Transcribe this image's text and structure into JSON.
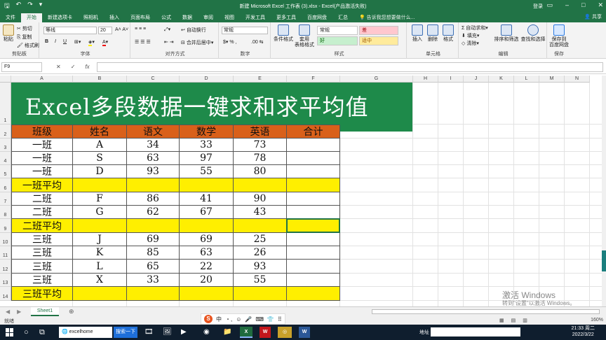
{
  "title_bar": {
    "title": "新建 Microsoft Excel 工作表 (3).xlsx - Excel(产品激活失败)",
    "signin": "登录",
    "share": "共享"
  },
  "menu": {
    "tabs": [
      "文件",
      "开始",
      "新建选项卡",
      "照相机",
      "插入",
      "页面布局",
      "公式",
      "数据",
      "审阅",
      "视图",
      "开发工具",
      "更多工具",
      "百度网盘",
      "汇总"
    ],
    "active_tab": "开始",
    "tell_me": "告诉我您想要做什么..."
  },
  "ribbon": {
    "clipboard": {
      "label": "剪贴板",
      "paste": "粘贴",
      "cut": "剪切",
      "copy": "复制",
      "format_painter": "格式刷"
    },
    "font": {
      "label": "字体",
      "name": "等线",
      "size": "20",
      "bold": "B",
      "italic": "I",
      "underline": "U"
    },
    "alignment": {
      "label": "对齐方式",
      "wrap": "自动换行",
      "merge": "合并后居中"
    },
    "number": {
      "label": "数字",
      "format": "常规",
      "percent": "%"
    },
    "styles": {
      "label": "样式",
      "cond_format": "条件格式",
      "table_format": "套用\n表格格式",
      "normal": "常规",
      "bad": "差",
      "good": "好",
      "neutral": "适中"
    },
    "cells": {
      "label": "单元格",
      "insert": "插入",
      "delete": "删除",
      "format": "格式"
    },
    "editing": {
      "label": "编辑",
      "autosum": "自动求和",
      "fill": "填充",
      "clear": "清除",
      "sort_filter": "排序和筛选",
      "find_select": "查找和选择"
    },
    "save": {
      "label": "保存",
      "save_to_baidu": "保存到\n百度网盘"
    }
  },
  "formula_bar": {
    "name_box": "F9",
    "cancel": "✕",
    "enter": "✓",
    "fx": "fx",
    "formula": ""
  },
  "columns": [
    "A",
    "B",
    "C",
    "D",
    "E",
    "F",
    "G",
    "H",
    "I",
    "J",
    "K",
    "L",
    "M",
    "N"
  ],
  "rows": [
    "1",
    "2",
    "3",
    "4",
    "5",
    "6",
    "7",
    "8",
    "9",
    "10",
    "11",
    "12",
    "13",
    "14"
  ],
  "banner_text": "Excel多段数据一键求和求平均值",
  "table": {
    "header": [
      "班级",
      "姓名",
      "语文",
      "数学",
      "英语",
      "合计"
    ],
    "rows": [
      {
        "type": "data",
        "cells": [
          "一班",
          "A",
          "34",
          "33",
          "73",
          ""
        ]
      },
      {
        "type": "data",
        "cells": [
          "一班",
          "S",
          "63",
          "97",
          "78",
          ""
        ]
      },
      {
        "type": "data",
        "cells": [
          "一班",
          "D",
          "93",
          "55",
          "80",
          ""
        ]
      },
      {
        "type": "avg",
        "cells": [
          "一班平均",
          "",
          "",
          "",
          "",
          ""
        ]
      },
      {
        "type": "data",
        "cells": [
          "二班",
          "F",
          "86",
          "41",
          "90",
          ""
        ]
      },
      {
        "type": "data",
        "cells": [
          "二班",
          "G",
          "62",
          "67",
          "43",
          ""
        ]
      },
      {
        "type": "avg",
        "cells": [
          "二班平均",
          "",
          "",
          "",
          "",
          ""
        ]
      },
      {
        "type": "data",
        "cells": [
          "三班",
          "J",
          "69",
          "69",
          "25",
          ""
        ]
      },
      {
        "type": "data",
        "cells": [
          "三班",
          "K",
          "85",
          "63",
          "26",
          ""
        ]
      },
      {
        "type": "data",
        "cells": [
          "三班",
          "L",
          "65",
          "22",
          "93",
          ""
        ]
      },
      {
        "type": "data",
        "cells": [
          "三班",
          "X",
          "33",
          "20",
          "55",
          ""
        ]
      },
      {
        "type": "avg",
        "cells": [
          "三班平均",
          "",
          "",
          "",
          "",
          ""
        ]
      }
    ]
  },
  "sheet_tabs": {
    "active": "Sheet1"
  },
  "status": {
    "ready": "就绪",
    "zoom": "160%"
  },
  "watermark": {
    "line1": "激活 Windows",
    "line2": "转到\"设置\"以激活 Windows。"
  },
  "ime": {
    "lang": "中"
  },
  "taskbar": {
    "search": "excelhome",
    "search_btn": "搜索一下",
    "address_label": "地址",
    "time": "21:33 周二",
    "date": "2022/3/22"
  },
  "colors": {
    "brand": "#217346",
    "banner": "#1e8a4a",
    "header_fill": "#d9601a",
    "avg_fill": "#ffef00"
  }
}
